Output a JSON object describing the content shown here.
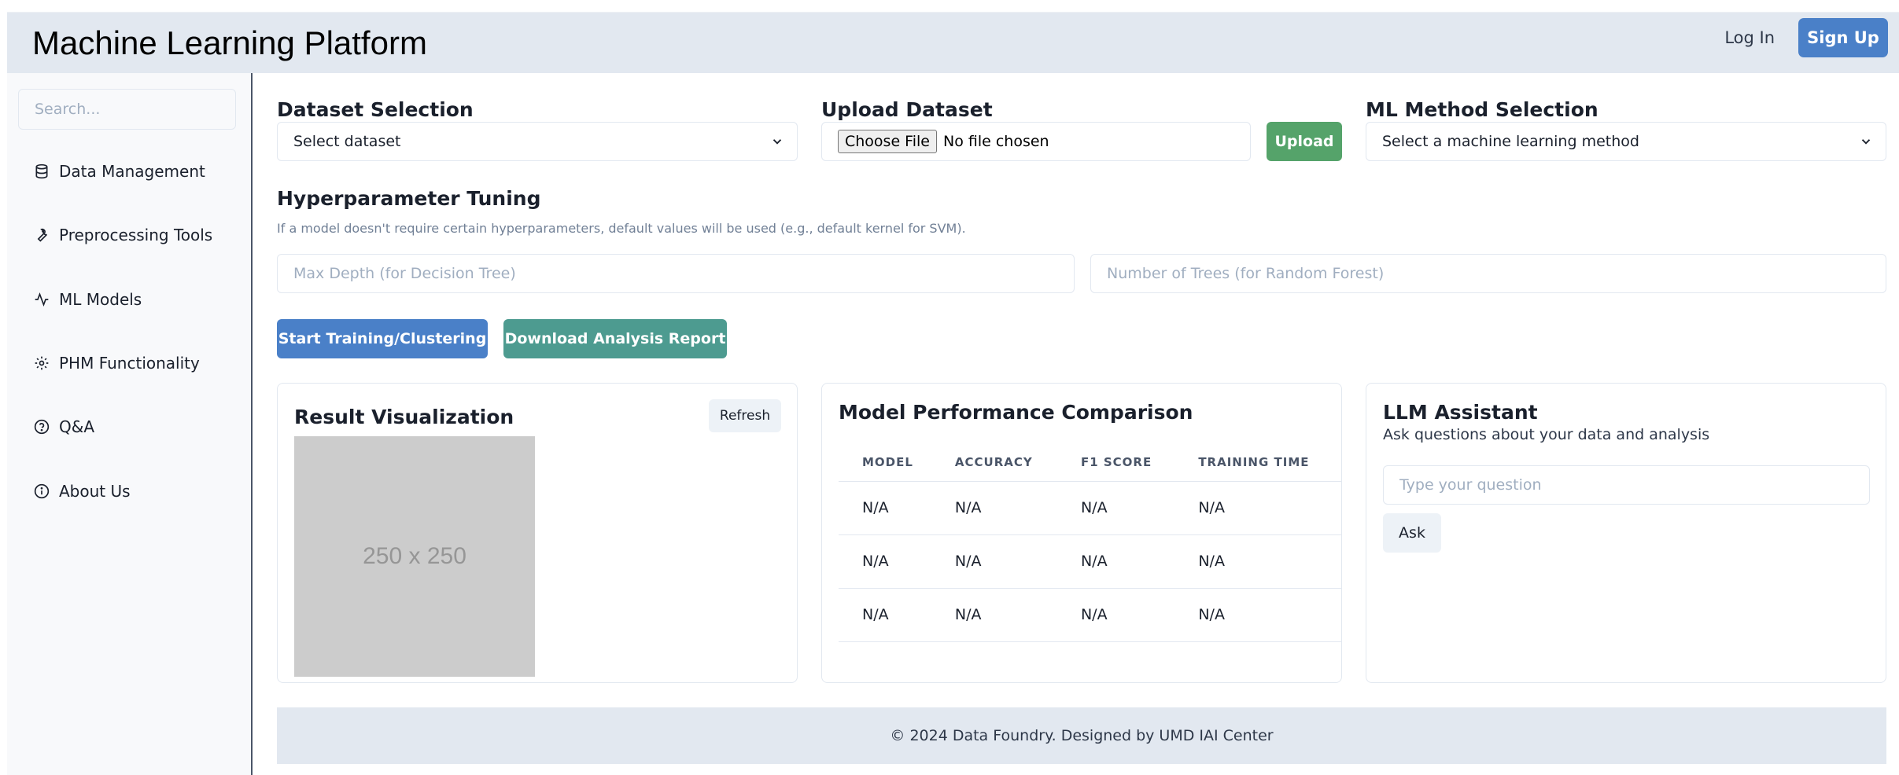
{
  "header": {
    "title": "Machine Learning Platform",
    "login_label": "Log In",
    "signup_label": "Sign Up"
  },
  "sidebar": {
    "search_placeholder": "Search...",
    "items": [
      {
        "label": "Data Management",
        "icon": "database-icon"
      },
      {
        "label": "Preprocessing Tools",
        "icon": "wrench-icon"
      },
      {
        "label": "ML Models",
        "icon": "activity-icon"
      },
      {
        "label": "PHM Functionality",
        "icon": "gear-icon"
      },
      {
        "label": "Q&A",
        "icon": "question-circle-icon"
      },
      {
        "label": "About Us",
        "icon": "info-circle-icon"
      }
    ]
  },
  "dataset": {
    "title": "Dataset Selection",
    "selected": "Select dataset"
  },
  "upload": {
    "title": "Upload Dataset",
    "choose_label": "Choose File",
    "file_status": "No file chosen",
    "upload_label": "Upload"
  },
  "method": {
    "title": "ML Method Selection",
    "selected": "Select a machine learning method"
  },
  "hyperparams": {
    "title": "Hyperparameter Tuning",
    "hint": "If a model doesn't require certain hyperparameters, default values will be used (e.g., default kernel for SVM).",
    "max_depth_placeholder": "Max Depth (for Decision Tree)",
    "num_trees_placeholder": "Number of Trees (for Random Forest)"
  },
  "actions": {
    "train_label": "Start Training/Clustering",
    "report_label": "Download Analysis Report"
  },
  "result": {
    "title": "Result Visualization",
    "refresh_label": "Refresh",
    "image_text": "250 x 250"
  },
  "performance": {
    "title": "Model Performance Comparison",
    "columns": [
      "MODEL",
      "ACCURACY",
      "F1 SCORE",
      "TRAINING TIME"
    ],
    "rows": [
      [
        "N/A",
        "N/A",
        "N/A",
        "N/A"
      ],
      [
        "N/A",
        "N/A",
        "N/A",
        "N/A"
      ],
      [
        "N/A",
        "N/A",
        "N/A",
        "N/A"
      ]
    ]
  },
  "llm": {
    "title": "LLM Assistant",
    "subtitle": "Ask questions about your data and analysis",
    "input_placeholder": "Type your question",
    "ask_label": "Ask"
  },
  "footer": {
    "text": "© 2024 Data Foundry. Designed by UMD IAI Center"
  }
}
